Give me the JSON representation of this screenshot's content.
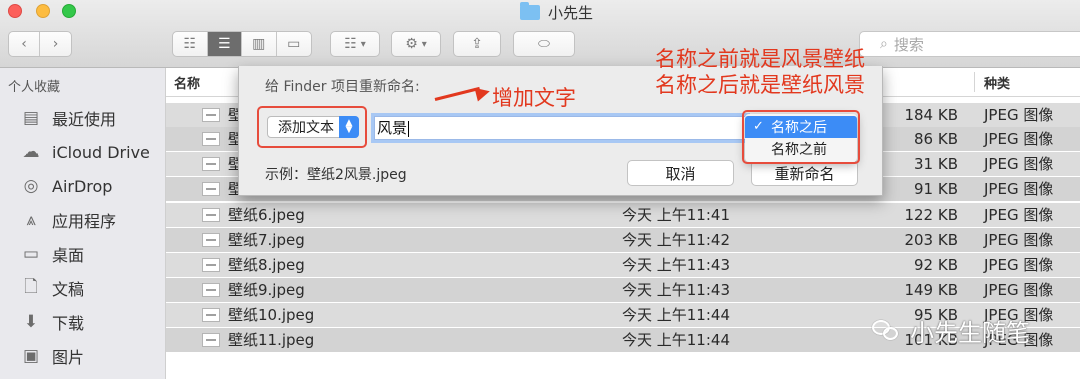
{
  "window": {
    "title": "小先生"
  },
  "toolbar": {
    "back_icon": "chevron-left-icon",
    "forward_icon": "chevron-right-icon",
    "search_placeholder": "搜索"
  },
  "sidebar": {
    "heading": "个人收藏",
    "items": [
      {
        "label": "最近使用",
        "icon": "recents-icon"
      },
      {
        "label": "iCloud Drive",
        "icon": "cloud-icon"
      },
      {
        "label": "AirDrop",
        "icon": "airdrop-icon"
      },
      {
        "label": "应用程序",
        "icon": "applications-icon"
      },
      {
        "label": "桌面",
        "icon": "desktop-icon"
      },
      {
        "label": "文稿",
        "icon": "documents-icon"
      },
      {
        "label": "下载",
        "icon": "download-icon"
      },
      {
        "label": "图片",
        "icon": "pictures-icon"
      }
    ]
  },
  "columns": {
    "name": "名称",
    "kind": "种类"
  },
  "files": [
    {
      "name": "壁",
      "date": "",
      "size": "184 KB",
      "kind": "JPEG 图像"
    },
    {
      "name": "壁",
      "date": "",
      "size": "86 KB",
      "kind": "JPEG 图像"
    },
    {
      "name": "壁",
      "date": "",
      "size": "31 KB",
      "kind": "JPEG 图像"
    },
    {
      "name": "壁",
      "date": "",
      "size": "91 KB",
      "kind": "JPEG 图像"
    },
    {
      "name": "壁纸6.jpeg",
      "date": "今天 上午11:41",
      "size": "122 KB",
      "kind": "JPEG 图像"
    },
    {
      "name": "壁纸7.jpeg",
      "date": "今天 上午11:42",
      "size": "203 KB",
      "kind": "JPEG 图像"
    },
    {
      "name": "壁纸8.jpeg",
      "date": "今天 上午11:43",
      "size": "92 KB",
      "kind": "JPEG 图像"
    },
    {
      "name": "壁纸9.jpeg",
      "date": "今天 上午11:43",
      "size": "149 KB",
      "kind": "JPEG 图像"
    },
    {
      "name": "壁纸10.jpeg",
      "date": "今天 上午11:44",
      "size": "95 KB",
      "kind": "JPEG 图像"
    },
    {
      "name": "壁纸11.jpeg",
      "date": "今天 上午11:44",
      "size": "101 KB",
      "kind": "JPEG 图像"
    }
  ],
  "rename_sheet": {
    "title": "给 Finder 项目重新命名:",
    "mode_label": "添加文本",
    "text_value": "风景",
    "example": "示例：壁纸2风景.jpeg",
    "cancel_label": "取消",
    "rename_label": "重新命名"
  },
  "position_menu": {
    "options": [
      "名称之后",
      "名称之前"
    ],
    "selected": "名称之后",
    "check": "✓"
  },
  "annotations": {
    "add_text": "增加文字",
    "before_note": "名称之前就是风景壁纸",
    "after_note": "名称之后就是壁纸风景",
    "color": "#e2381e"
  },
  "watermark": "小先生随笔"
}
